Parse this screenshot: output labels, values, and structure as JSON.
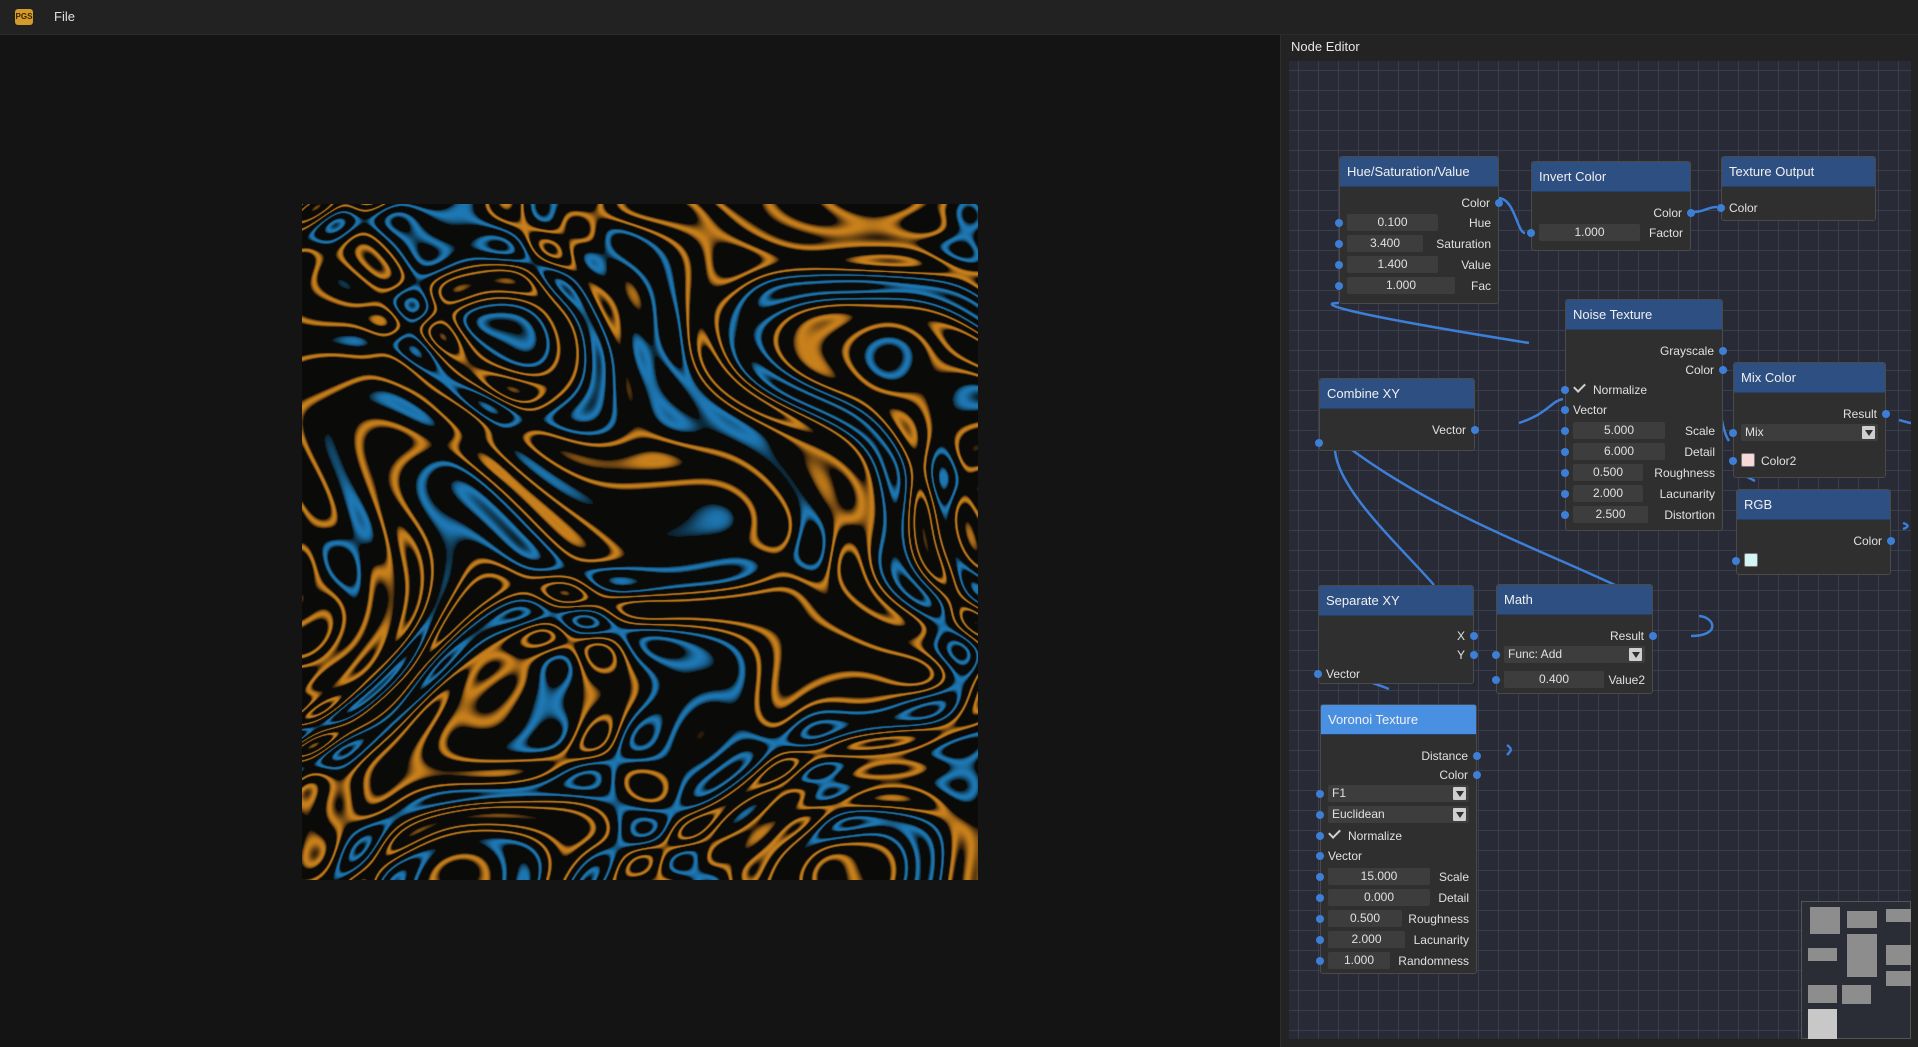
{
  "app": {
    "logo_text": "PGS",
    "menu": {
      "file": "File"
    }
  },
  "panel": {
    "title": "Node Editor"
  },
  "nodes": {
    "hsv": {
      "title": "Hue/Saturation/Value",
      "out_color": "Color",
      "hue": "0.100",
      "hue_label": "Hue",
      "saturation": "3.400",
      "saturation_label": "Saturation",
      "value": "1.400",
      "value_label": "Value",
      "fac": "1.000",
      "fac_label": "Fac"
    },
    "invert": {
      "title": "Invert Color",
      "out_color": "Color",
      "factor": "1.000",
      "factor_label": "Factor"
    },
    "output": {
      "title": "Texture Output",
      "in_color": "Color"
    },
    "noise": {
      "title": "Noise Texture",
      "out_grayscale": "Grayscale",
      "out_color": "Color",
      "normalize": "Normalize",
      "vector": "Vector",
      "scale": "5.000",
      "scale_label": "Scale",
      "detail": "6.000",
      "detail_label": "Detail",
      "roughness": "0.500",
      "roughness_label": "Roughness",
      "lacunarity": "2.000",
      "lacunarity_label": "Lacunarity",
      "distortion": "2.500",
      "distortion_label": "Distortion"
    },
    "mix": {
      "title": "Mix Color",
      "out_result": "Result",
      "mode": "Mix",
      "color2_label": "Color2",
      "color2_swatch": "#f7d9d9"
    },
    "rgb": {
      "title": "RGB",
      "out_color": "Color",
      "swatch": "#d5f5f5"
    },
    "combine": {
      "title": "Combine XY",
      "out_vector": "Vector"
    },
    "separate": {
      "title": "Separate XY",
      "out_x": "X",
      "out_y": "Y",
      "in_vector": "Vector"
    },
    "math": {
      "title": "Math",
      "out_result": "Result",
      "func": "Func: Add",
      "value2": "0.400",
      "value2_label": "Value2"
    },
    "voronoi": {
      "title": "Voronoi Texture",
      "out_distance": "Distance",
      "out_color": "Color",
      "feature": "F1",
      "metric": "Euclidean",
      "normalize": "Normalize",
      "vector": "Vector",
      "scale": "15.000",
      "scale_label": "Scale",
      "detail": "0.000",
      "detail_label": "Detail",
      "roughness": "0.500",
      "roughness_label": "Roughness",
      "lacunarity": "2.000",
      "lacunarity_label": "Lacunarity",
      "randomness": "1.000",
      "randomness_label": "Randomness"
    }
  },
  "colors": {
    "header": "#2d4f82",
    "header_selected": "#4a90e2",
    "socket": "#3d7fd6",
    "wire": "#3d7fd6",
    "texture_orange": "#c8801c",
    "texture_blue": "#1c78b4"
  }
}
